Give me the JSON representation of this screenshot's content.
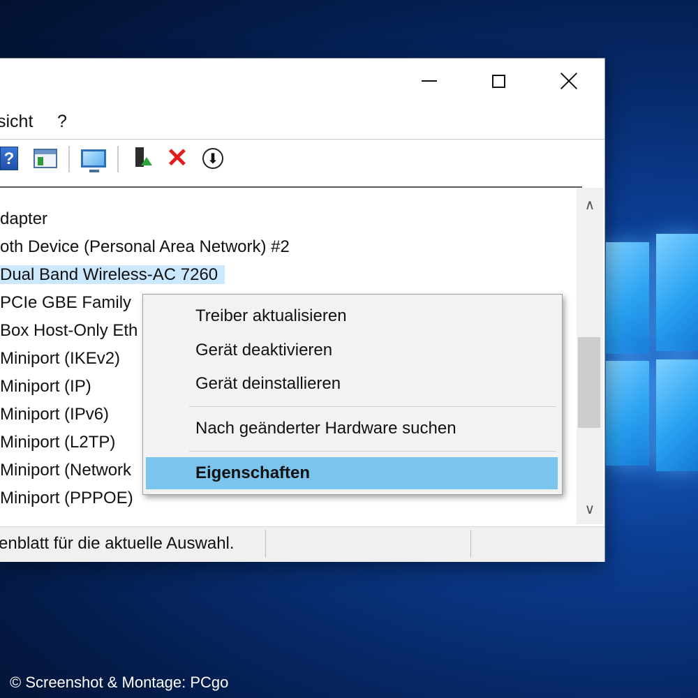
{
  "window": {
    "menu": [
      "sicht",
      "?"
    ],
    "controls": {
      "minimize": "minimize",
      "maximize": "maximize",
      "close": "close"
    }
  },
  "toolbar": {
    "icons": [
      "help-icon",
      "properties-panel-icon",
      "scan-hardware-icon",
      "update-driver-icon",
      "uninstall-icon",
      "download-icon"
    ],
    "help_glyph": "?",
    "uninstall_glyph": "✕",
    "download_glyph": "⬇"
  },
  "tree": {
    "rows": [
      "dapter",
      "oth Device (Personal Area Network) #2",
      " Dual Band Wireless-AC 7260",
      " PCIe GBE Family",
      "Box Host-Only Eth",
      "Miniport (IKEv2)",
      "Miniport (IP)",
      "Miniport (IPv6)",
      "Miniport (L2TP)",
      "Miniport (Network",
      "Miniport (PPPOE)"
    ],
    "selected_index": 2
  },
  "scrollbar": {
    "up": "∧",
    "down": "∨"
  },
  "context_menu": {
    "items": [
      "Treiber aktualisieren",
      "Gerät deaktivieren",
      "Gerät deinstallieren",
      "Nach geänderter Hardware suchen",
      "Eigenschaften"
    ],
    "highlighted": "Eigenschaften"
  },
  "statusbar": {
    "text": "enblatt für die aktuelle Auswahl."
  },
  "credit": "© Screenshot & Montage: PCgo",
  "colors": {
    "selection": "#cce8ff",
    "menu_highlight": "#7ac4ee",
    "desktop_blue": "#0b3f96"
  }
}
